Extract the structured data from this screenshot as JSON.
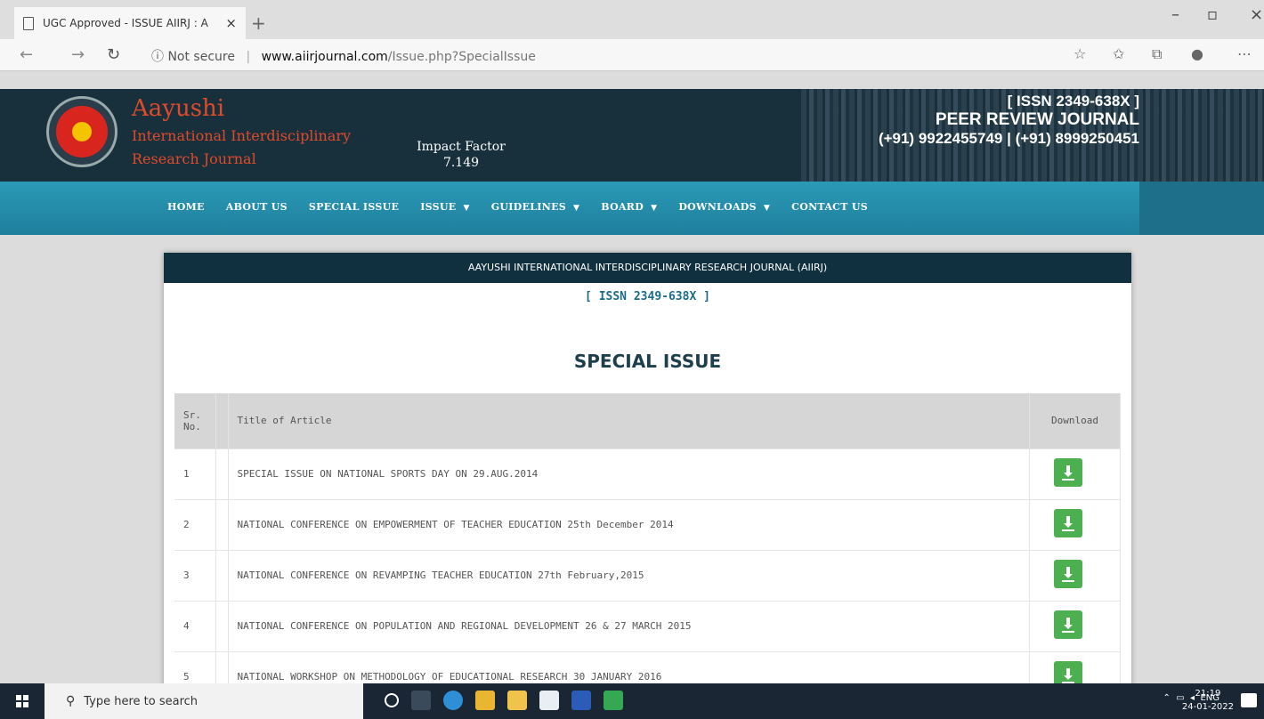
{
  "browser": {
    "tab_title": "UGC Approved - ISSUE AIIRJ : A",
    "tab_close": "×",
    "new_tab": "+",
    "security": "Not secure",
    "url_host": "www.aiirjournal.com",
    "url_path": "/Issue.php?SpecialIssue"
  },
  "header": {
    "brand_line1": "Aayushi",
    "brand_line2": "International Interdisciplinary",
    "brand_line3": "Research Journal",
    "impact_label": "Impact Factor",
    "impact_value": "7.149",
    "issn": "[ ISSN 2349-638X ]",
    "peer_review": "PEER REVIEW JOURNAL",
    "phones": "(+91) 9922455749 | (+91) 8999250451"
  },
  "nav": {
    "items": [
      {
        "label": "HOME",
        "dropdown": false
      },
      {
        "label": "ABOUT US",
        "dropdown": false
      },
      {
        "label": "SPECIAL ISSUE",
        "dropdown": false
      },
      {
        "label": "ISSUE",
        "dropdown": true
      },
      {
        "label": "GUIDELINES",
        "dropdown": true
      },
      {
        "label": "BOARD",
        "dropdown": true
      },
      {
        "label": "DOWNLOADS",
        "dropdown": true
      },
      {
        "label": "CONTACT US",
        "dropdown": false
      }
    ]
  },
  "content": {
    "journal_name": "AAYUSHI INTERNATIONAL INTERDISCIPLINARY RESEARCH JOURNAL (AIIRJ)",
    "issn": "[ ISSN 2349-638X ]",
    "section_title": "SPECIAL ISSUE",
    "table": {
      "col_no": "Sr. No.",
      "col_title": "Title of Article",
      "col_download": "Download",
      "rows": [
        {
          "no": "1",
          "title": "SPECIAL ISSUE ON NATIONAL SPORTS DAY ON 29.AUG.2014"
        },
        {
          "no": "2",
          "title": "NATIONAL CONFERENCE ON EMPOWERMENT OF TEACHER EDUCATION 25th December 2014"
        },
        {
          "no": "3",
          "title": "NATIONAL CONFERENCE ON REVAMPING TEACHER EDUCATION 27th February,2015"
        },
        {
          "no": "4",
          "title": "NATIONAL CONFERENCE ON POPULATION AND REGIONAL DEVELOPMENT 26 & 27 MARCH 2015"
        },
        {
          "no": "5",
          "title": "NATIONAL WORKSHOP ON METHODOLOGY OF EDUCATIONAL RESEARCH 30 JANUARY 2016"
        }
      ]
    }
  },
  "taskbar": {
    "search_placeholder": "Type here to search",
    "language": "ENG",
    "time": "21:19",
    "date": "24-01-2022"
  }
}
